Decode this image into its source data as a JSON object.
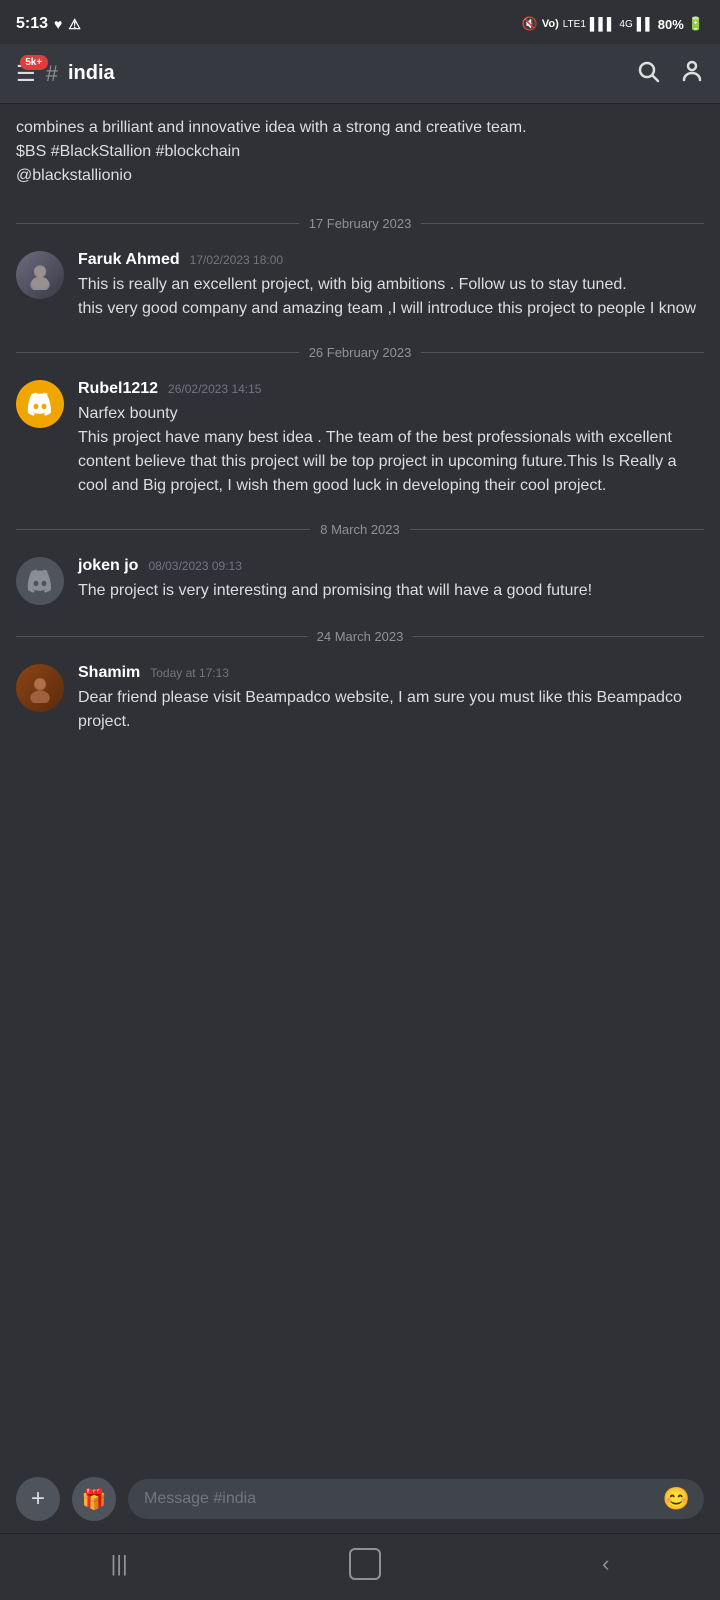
{
  "statusBar": {
    "time": "5:13",
    "battery": "80%",
    "icons": [
      "🔕",
      "Vo)",
      "LTE1",
      "4G"
    ]
  },
  "header": {
    "badge": "5k+",
    "hash": "#",
    "channel": "india"
  },
  "partialMessage": {
    "text": "combines a brilliant and innovative idea with a strong and creative team.\n$BS #BlackStallion #blockchain\n@blackstallionio"
  },
  "dateDividers": {
    "feb17": "17 February 2023",
    "feb26": "26 February 2023",
    "mar8": "8 March 2023",
    "mar24": "24 March 2023"
  },
  "messages": [
    {
      "id": "msg1",
      "username": "Faruk Ahmed",
      "timestamp": "17/02/2023 18:00",
      "text": "This is really an excellent project, with big ambitions . Follow us to stay tuned.\nthis very good company and amazing team ,I will introduce this project to people I know",
      "avatarType": "photo-faruk"
    },
    {
      "id": "msg2",
      "username": "Rubel1212",
      "timestamp": "26/02/2023 14:15",
      "text": "Narfex bounty\nThis project have many best idea . The team of the best professionals with excellent content believe that this project will be top project in upcoming future.This Is Really a cool and Big project, I wish them good luck in developing their cool project.",
      "avatarType": "discord-orange"
    },
    {
      "id": "msg3",
      "username": "joken  jo",
      "timestamp": "08/03/2023 09:13",
      "text": "The project is very interesting and promising that will have a good future!",
      "avatarType": "discord-gray"
    },
    {
      "id": "msg4",
      "username": "Shamim",
      "timestamp": "Today at 17:13",
      "text": "Dear friend please visit Beampadco  website, I am sure you must like this Beampadco  project.",
      "avatarType": "photo-shamim"
    }
  ],
  "inputBar": {
    "placeholder": "Message #india",
    "plusLabel": "+",
    "giftIcon": "🎁",
    "emojiIcon": "😊"
  }
}
